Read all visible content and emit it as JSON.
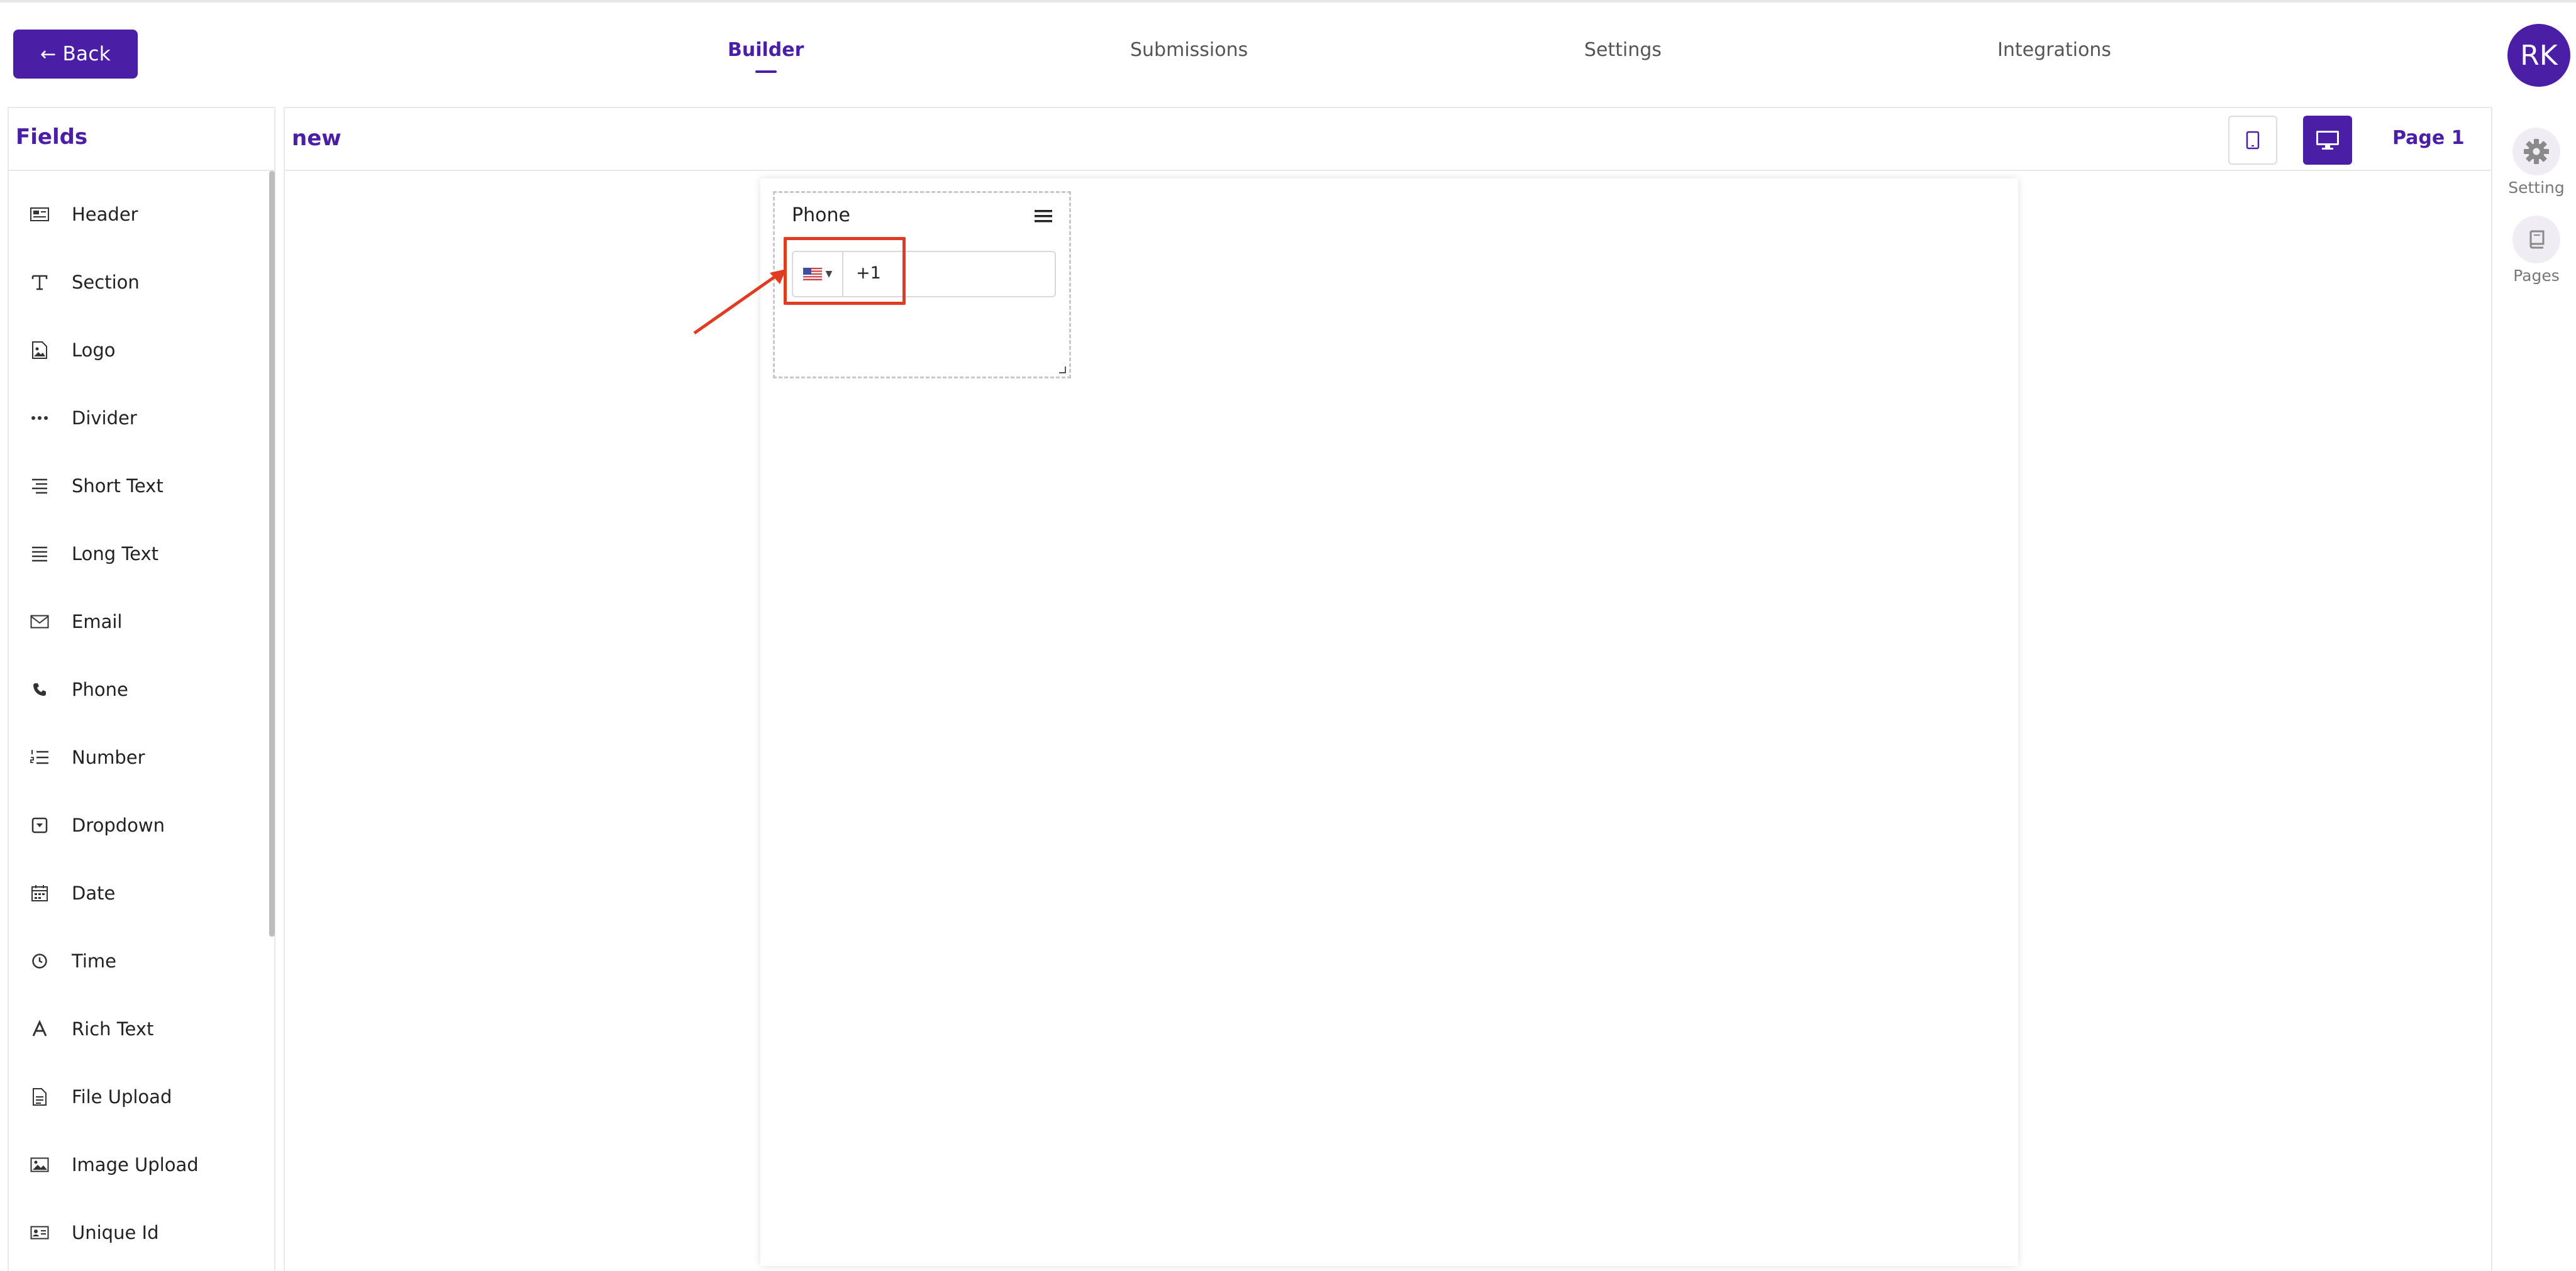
{
  "header": {
    "back_label": "Back",
    "tabs": [
      {
        "label": "Builder",
        "active": true
      },
      {
        "label": "Submissions",
        "active": false
      },
      {
        "label": "Settings",
        "active": false
      },
      {
        "label": "Integrations",
        "active": false
      }
    ],
    "avatar_initials": "RK"
  },
  "sidebar": {
    "title": "Fields",
    "items": [
      {
        "label": "Header",
        "icon": "header-icon"
      },
      {
        "label": "Section",
        "icon": "text-t-icon"
      },
      {
        "label": "Logo",
        "icon": "image-file-icon"
      },
      {
        "label": "Divider",
        "icon": "dots-icon"
      },
      {
        "label": "Short Text",
        "icon": "short-text-icon"
      },
      {
        "label": "Long Text",
        "icon": "long-text-icon"
      },
      {
        "label": "Email",
        "icon": "mail-icon"
      },
      {
        "label": "Phone",
        "icon": "phone-icon"
      },
      {
        "label": "Number",
        "icon": "numbered-list-icon"
      },
      {
        "label": "Dropdown",
        "icon": "dropdown-icon"
      },
      {
        "label": "Date",
        "icon": "calendar-icon"
      },
      {
        "label": "Time",
        "icon": "clock-icon"
      },
      {
        "label": "Rich Text",
        "icon": "rich-text-a-icon"
      },
      {
        "label": "File Upload",
        "icon": "file-icon"
      },
      {
        "label": "Image Upload",
        "icon": "image-icon"
      },
      {
        "label": "Unique Id",
        "icon": "id-card-icon"
      }
    ]
  },
  "canvas": {
    "form_name": "new",
    "page_label": "Page 1",
    "selected_device": "desktop",
    "phone_field": {
      "label": "Phone",
      "country": "US",
      "dial_code": "+1"
    }
  },
  "rail": {
    "setting_label": "Setting",
    "pages_label": "Pages"
  },
  "colors": {
    "brand": "#4a1fa6",
    "annotation": "#e03c22"
  }
}
